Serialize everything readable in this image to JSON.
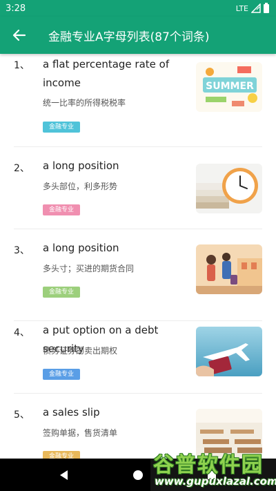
{
  "status_bar": {
    "time": "3:28",
    "network": "LTE"
  },
  "header": {
    "title": "金融专业A字母列表(87个词条)"
  },
  "items": [
    {
      "index": "1、",
      "term": "a flat percentage rate of income",
      "meaning": "统一比率的所得税税率",
      "tag": "金融专业",
      "tag_color": "#4fc3d9",
      "image": "summer-poster"
    },
    {
      "index": "2、",
      "term": "a long position",
      "meaning": "多头部位，利多形势",
      "tag": "金融专业",
      "tag_color": "#f08fb0",
      "image": "clock-and-books"
    },
    {
      "index": "3、",
      "term": "a long position",
      "meaning": "多头寸；买进的期货合同",
      "tag": "金融专业",
      "tag_color": "#9ccf7c",
      "image": "travelers-illustration"
    },
    {
      "index": "4、",
      "term": "a put option on a debt security",
      "meaning": "债务证券的卖出期权",
      "tag": "金融专业",
      "tag_color": "#5a9ee6",
      "image": "airplane-passport"
    },
    {
      "index": "5、",
      "term": "a sales slip",
      "meaning": "签购单据，售货清单",
      "tag": "金融专业",
      "tag_color": "#e8b85a",
      "image": "classroom"
    }
  ],
  "watermark": {
    "title": "谷普软件园",
    "url": "www.gupuxlazal.com"
  },
  "colors": {
    "primary": "#14a276"
  }
}
